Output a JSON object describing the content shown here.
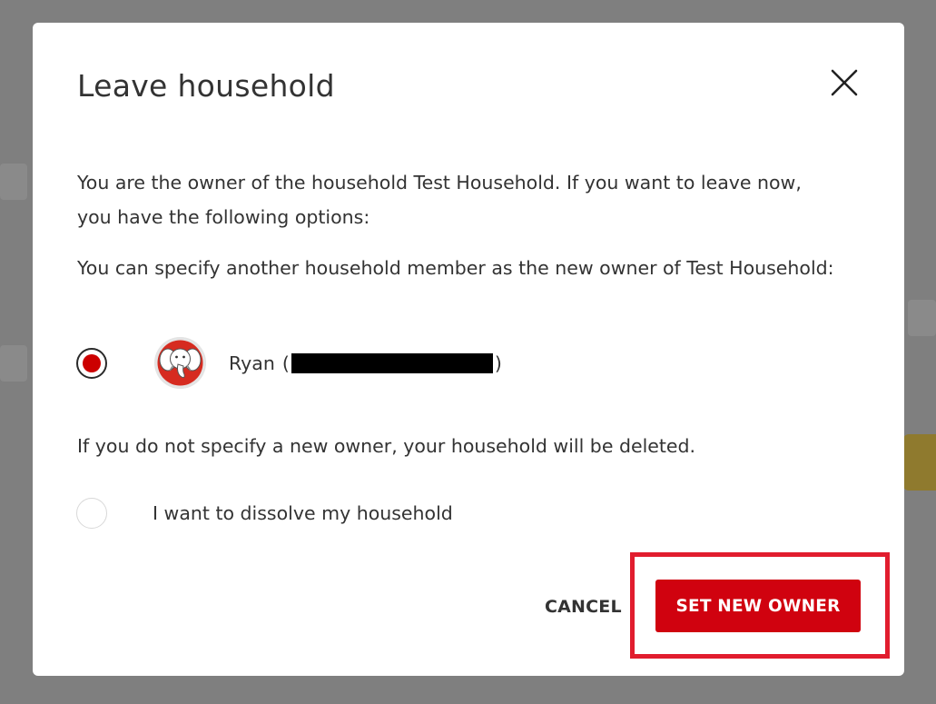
{
  "dialog": {
    "title": "Leave household",
    "close_icon": "close-icon",
    "intro_text": "You are the owner of the household Test Household. If you want to leave now, you have the following options:",
    "specify_text": "You can specify another household member as the new owner of Test Household:",
    "member": {
      "name": "Ryan",
      "open_paren": "(",
      "close_paren": ")",
      "avatar_icon": "elephant-avatar-icon",
      "selected": true
    },
    "warning_text": "If you do not specify a new owner, your household will be deleted.",
    "dissolve_option": {
      "label": "I want to dissolve my household",
      "selected": false
    },
    "actions": {
      "cancel_label": "CANCEL",
      "primary_label": "SET NEW OWNER"
    }
  },
  "colors": {
    "primary": "#d0020f",
    "highlight": "#e11d2e",
    "text": "#333333",
    "backdrop": "#7f7f7f"
  }
}
